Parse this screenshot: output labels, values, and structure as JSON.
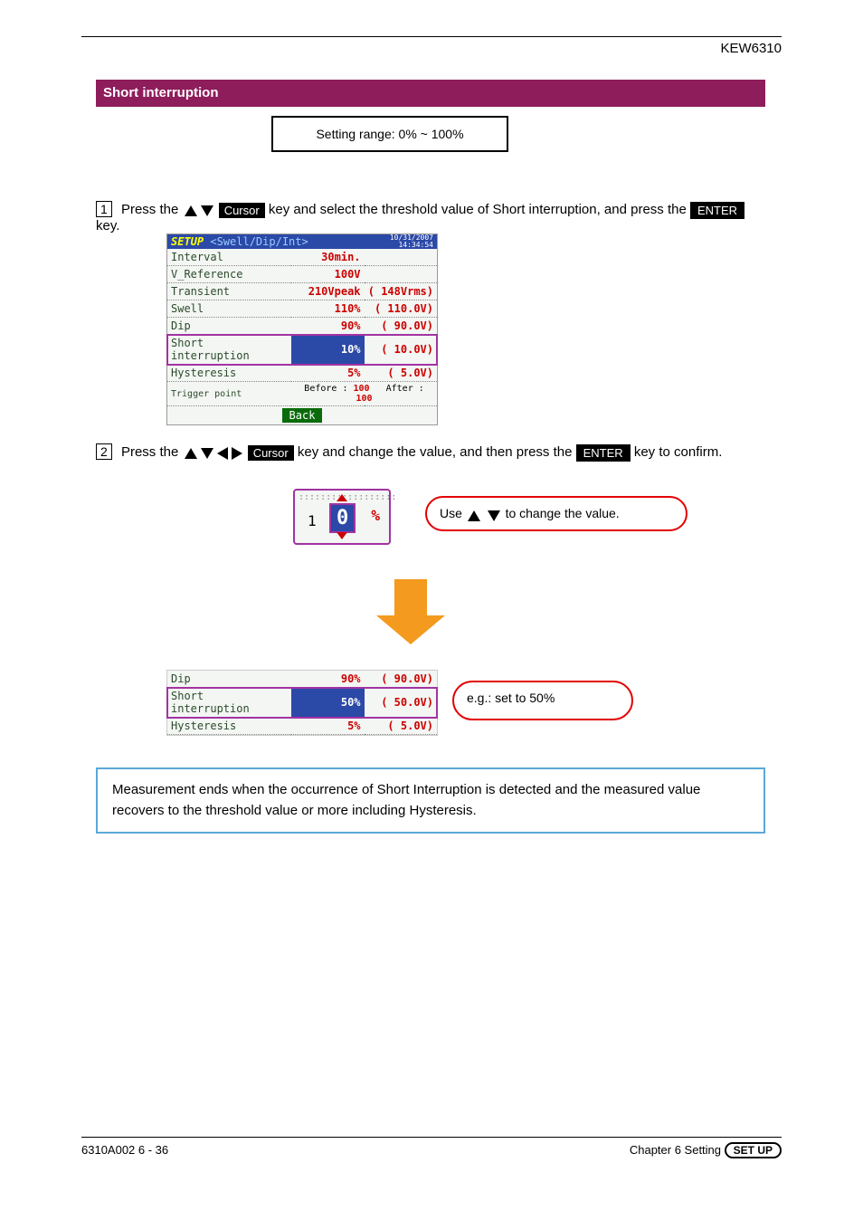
{
  "header_text": "KEW6310",
  "banner_title": "Short interruption",
  "range_box_text": "Setting range: 0% ~ 100%",
  "step1": {
    "prefix": "Press the",
    "cursor_word": "Cursor",
    "mid": "key and select the threshold value of Short interruption, and press the",
    "enter": "ENTER",
    "suffix": "key."
  },
  "step2": {
    "prefix": "Press the",
    "cursor_word": "Cursor",
    "mid": "key and change the value, and then press the",
    "enter": "ENTER",
    "suffix": "key to confirm."
  },
  "screenshot1": {
    "title_main": "SETUP",
    "title_sub": "<Swell/Dip/Int>",
    "date": "10/31/2007",
    "time": "14:34:54",
    "rows": [
      {
        "label": "Interval",
        "val": "30min.",
        "paren": ""
      },
      {
        "label": "V_Reference",
        "val": "100V",
        "paren": ""
      },
      {
        "label": "Transient",
        "val": "210Vpeak",
        "paren": "( 148Vrms)"
      },
      {
        "label": "Swell",
        "val": "110%",
        "paren": "(  110.0V)"
      },
      {
        "label": "Dip",
        "val": "90%",
        "paren": "(   90.0V)"
      },
      {
        "label": "Short interruption",
        "val": "10%",
        "paren": "(   10.0V)",
        "hl": true
      },
      {
        "label": "Hysteresis",
        "val": "5%",
        "paren": "(    5.0V)"
      }
    ],
    "trigger_label": "Trigger point",
    "trigger_before_lbl": "Before :",
    "trigger_before_val": "100",
    "trigger_after_lbl": "After :",
    "trigger_after_val": "100",
    "back_label": "Back"
  },
  "popup": {
    "digit": "0",
    "prefix_one": "1",
    "pct": "%",
    "callout_text": "Use         to change the value."
  },
  "screenshot2": {
    "rows": [
      {
        "label": "Dip",
        "val": "90%",
        "paren": "(   90.0V)"
      },
      {
        "label": "Short interruption",
        "val": "50%",
        "paren": "(   50.0V)",
        "hl": true
      },
      {
        "label": "Hysteresis",
        "val": "5%",
        "paren": "(    5.0V)"
      }
    ],
    "callout_text": "e.g.: set to 50%"
  },
  "infobox_text": "Measurement ends when the occurrence of Short Interruption is detected and the measured value recovers to the threshold value or more including Hysteresis.",
  "footer_left": "6310A002   6 - 36",
  "footer_right_prefix": "Chapter 6  Setting"
}
